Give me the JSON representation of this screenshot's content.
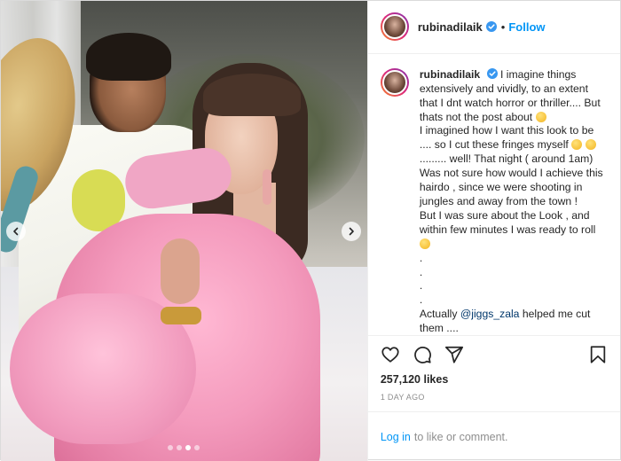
{
  "post": {
    "username": "rubinadilaik",
    "verified": true,
    "follow_label": "Follow",
    "separator": "•",
    "caption_lines": [
      "I imagine things",
      "extensively and vividly, to an extent",
      "that I dnt watch horror or thriller.... But",
      "thats not the post about"
    ],
    "caption_rest": [
      "I imagined how I want this look to be",
      ".... so I cut these fringes myself",
      "......... well! That night ( around 1am)",
      "Was not sure how would I achieve this",
      "hairdo , since we were shooting in",
      "jungles and away from the town !",
      "But I was sure about the Look , and",
      "within few minutes I was ready to roll",
      ".",
      ".",
      ".",
      "."
    ],
    "caption_mention_prefix": "Actually",
    "caption_mention": "@jiggs_zala",
    "caption_mention_suffix": "helped me cut",
    "caption_last": "them ....",
    "likes": "257,120 likes",
    "time": "1 DAY AGO",
    "login_link": "Log in",
    "login_text": "to like or comment."
  },
  "carousel": {
    "slide_count": 4,
    "active_index": 2
  },
  "icons": {
    "like": "heart-icon",
    "comment": "comment-icon",
    "share": "share-icon",
    "save": "bookmark-icon",
    "verified": "verified-badge-icon"
  },
  "colors": {
    "accent": "#0095f6",
    "verified": "#3897f0",
    "muted": "#8e8e8e",
    "text": "#262626"
  }
}
